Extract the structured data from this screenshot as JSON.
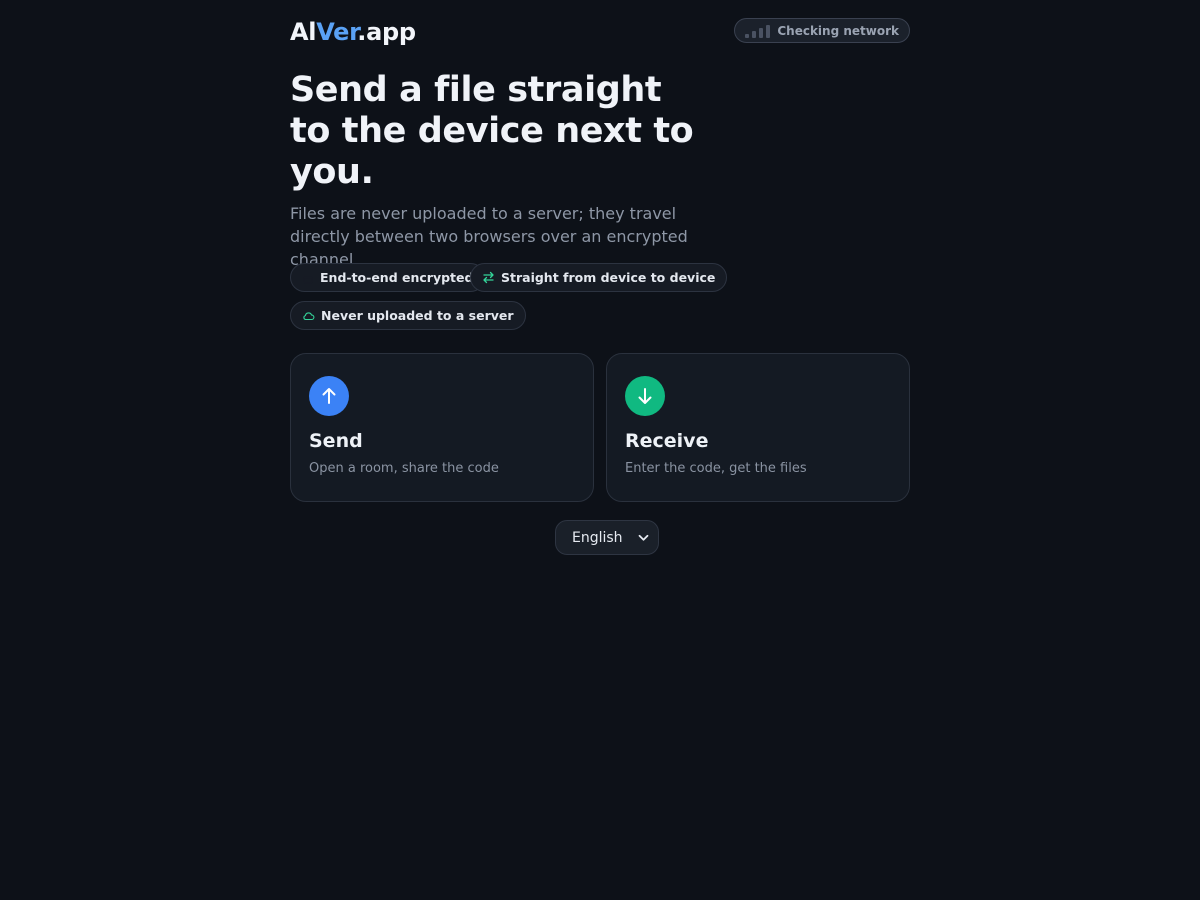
{
  "header": {
    "logo_part1": "Al",
    "logo_part2": "Ver",
    "logo_part3": ".app",
    "network_status": "Checking network"
  },
  "hero": {
    "title": "Send a file straight to the device next to you.",
    "subtitle": "Files are never uploaded to a server; they travel directly between two browsers over an encrypted channel."
  },
  "chips": [
    {
      "label": "End-to-end encrypted",
      "icon": "lock-icon"
    },
    {
      "label": "Straight from device to device",
      "icon": "swap-arrows-icon"
    },
    {
      "label": "Never uploaded to a server",
      "icon": "cloud-icon"
    }
  ],
  "cards": {
    "send": {
      "title": "Send",
      "description": "Open a room, share the code",
      "icon": "arrow-up-icon",
      "color": "#3b82f6"
    },
    "receive": {
      "title": "Receive",
      "description": "Enter the code, get the files",
      "icon": "arrow-down-icon",
      "color": "#10b981"
    }
  },
  "language": {
    "selected": "English"
  },
  "colors": {
    "background": "#0d1118",
    "accent": "#5aa2f5",
    "chip_icon": "#34d399"
  }
}
